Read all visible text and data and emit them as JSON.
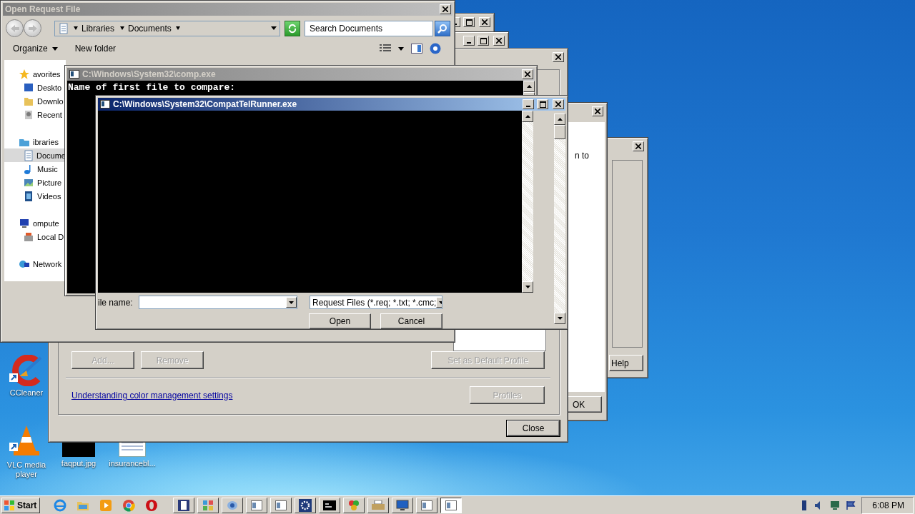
{
  "open_request_file": {
    "title": "Open Request File",
    "active": false,
    "breadcrumb": [
      "Libraries",
      "Documents"
    ],
    "search": {
      "placeholder": "Search Documents"
    },
    "toolbar": [
      "Organize",
      "New folder"
    ],
    "nav": [
      {
        "label": "avorites",
        "kind": "star",
        "selected": false,
        "children": [
          {
            "label": "Deskto",
            "kind": "desktop",
            "selected": false
          },
          {
            "label": "Downlo",
            "kind": "folder",
            "selected": false
          },
          {
            "label": "Recent",
            "kind": "recent",
            "selected": false
          }
        ]
      },
      {
        "label": "ibraries",
        "kind": "library",
        "selected": false,
        "children": [
          {
            "label": "Docume",
            "kind": "document",
            "selected": true
          },
          {
            "label": "Music",
            "kind": "music",
            "selected": false
          },
          {
            "label": "Picture",
            "kind": "pictures",
            "selected": false
          },
          {
            "label": "Videos",
            "kind": "videos",
            "selected": false
          }
        ]
      },
      {
        "label": "ompute",
        "kind": "computer",
        "selected": false,
        "children": [
          {
            "label": "Local D",
            "kind": "disk",
            "selected": false
          }
        ]
      },
      {
        "label": "Network",
        "kind": "network",
        "selected": false
      }
    ],
    "file_name_label": "ile name:",
    "file_type": "Request Files (*.req; *.txt; *.cmc;",
    "buttons": [
      "Open",
      "Cancel"
    ]
  },
  "color_management": {
    "active": false,
    "buttons": [
      {
        "label": "Add...",
        "disabled": true
      },
      {
        "label": "Remove",
        "disabled": true
      },
      {
        "label": "Set as Default Profile",
        "disabled": true
      }
    ],
    "link": "Understanding color management settings",
    "profiles": {
      "label": "Profiles",
      "disabled": true
    },
    "close": {
      "label": "Close",
      "disabled": false
    }
  },
  "back_dialog": {
    "text": "n to",
    "button": "OK"
  },
  "help_dialog": {
    "button": "Help"
  },
  "comp_console": {
    "title": "C:\\Windows\\System32\\comp.exe",
    "active": false,
    "lines": [
      "Name of first file to compare:"
    ]
  },
  "compattel_console": {
    "title": "C:\\Windows\\System32\\CompatTelRunner.exe",
    "active": true
  },
  "desktop_icons": [
    {
      "label": "CCleaner",
      "kind": "ccleaner"
    },
    {
      "label": "VLC media player",
      "kind": "vlc"
    },
    {
      "label": "faqput.jpg",
      "kind": "image"
    },
    {
      "label": "insurancebl...",
      "kind": "document"
    }
  ],
  "taskbar": {
    "start": "Start",
    "pinned": [
      {
        "kind": "ie"
      },
      {
        "kind": "explorer"
      },
      {
        "kind": "media"
      },
      {
        "kind": "chrome"
      },
      {
        "kind": "opera"
      }
    ],
    "tasks": [
      {
        "kind": "notepad",
        "selected": false
      },
      {
        "kind": "registry",
        "selected": false
      },
      {
        "kind": "blue-app",
        "selected": false
      },
      {
        "kind": "window",
        "selected": false
      },
      {
        "kind": "window",
        "selected": false
      },
      {
        "kind": "settings",
        "selected": false
      },
      {
        "kind": "console",
        "selected": false
      },
      {
        "kind": "colorful",
        "selected": false
      },
      {
        "kind": "printer",
        "selected": false
      },
      {
        "kind": "monitor",
        "selected": false
      },
      {
        "kind": "window",
        "selected": false
      },
      {
        "kind": "window",
        "selected": true
      }
    ],
    "clock": "6:08 PM"
  }
}
